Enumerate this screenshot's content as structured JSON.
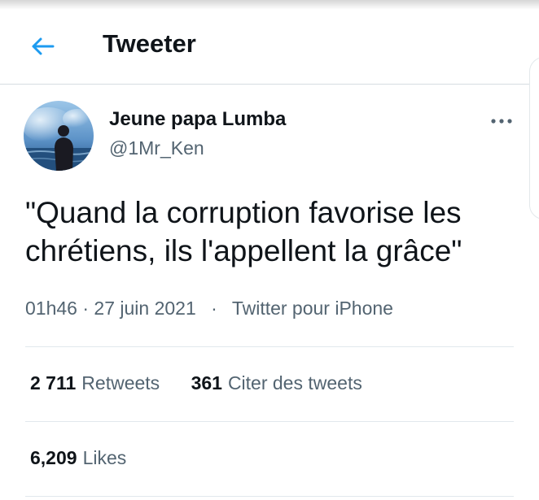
{
  "header": {
    "title": "Tweeter",
    "back_icon": "arrow-left-icon",
    "accent_color": "#1d9bf0"
  },
  "tweet": {
    "author_name": "Jeune papa Lumba",
    "author_handle": "@1Mr_Ken",
    "more_icon": "more-horizontal-icon",
    "text": "\"Quand la corruption favorise les chrétiens, ils l'appellent la grâce\"",
    "time": "01h46",
    "date": "27 juin 2021",
    "separator": "·",
    "source": "Twitter pour iPhone"
  },
  "stats": {
    "retweets_count": "2 711",
    "retweets_label": "Retweets",
    "quotes_count": "361",
    "quotes_label": "Citer des tweets",
    "likes_count": "6,209",
    "likes_label": "Likes"
  }
}
